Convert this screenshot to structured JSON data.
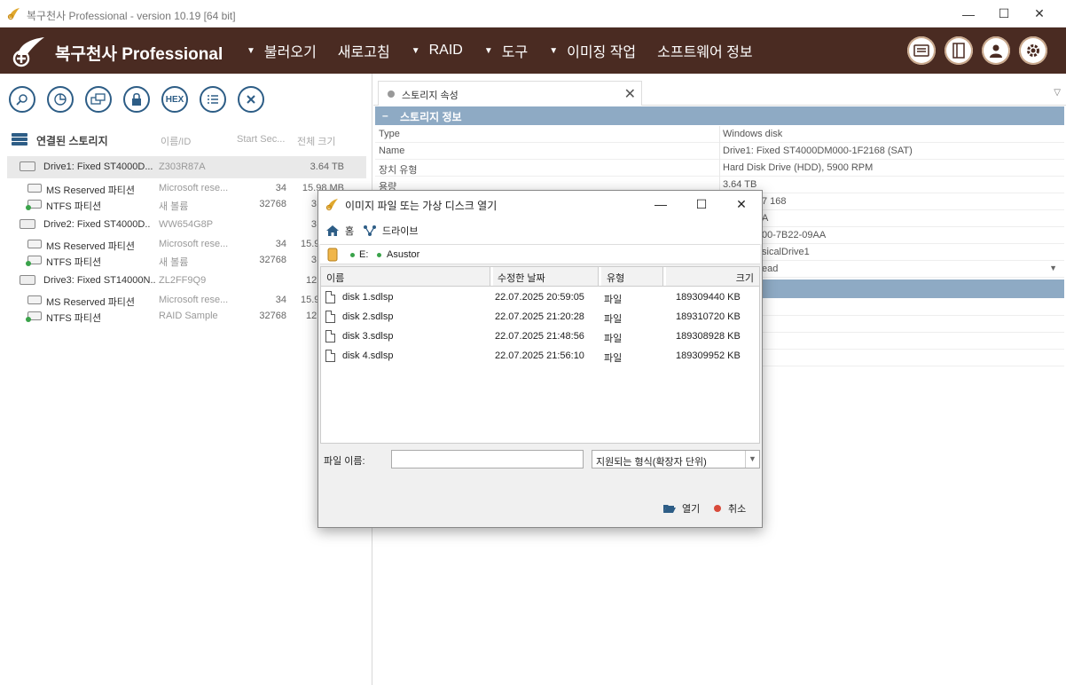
{
  "window": {
    "title": "복구천사 Professional - version 10.19 [64 bit]",
    "controls": {
      "minimize": "—",
      "maximize": "☐",
      "close": "✕"
    }
  },
  "header": {
    "brand": "복구천사 Professional",
    "menu": [
      {
        "label": "불러오기",
        "dropdown": true
      },
      {
        "label": "새로고침",
        "dropdown": false
      },
      {
        "label": "RAID",
        "dropdown": true
      },
      {
        "label": "도구",
        "dropdown": true
      },
      {
        "label": "이미징 작업",
        "dropdown": true
      },
      {
        "label": "소프트웨어 정보",
        "dropdown": false
      }
    ],
    "colors": {
      "bar": "#4a2b22"
    }
  },
  "toolbar": {
    "hex_label": "HEX",
    "icons": [
      "search-icon",
      "pie-chart-icon",
      "copy-disk-icon",
      "lock-icon",
      "hex-icon",
      "list-icon",
      "close-icon"
    ]
  },
  "tree": {
    "title": "연결된 스토리지",
    "columns": {
      "name_id": "이름/ID",
      "start": "Start Sec...",
      "size": "전체 크기"
    },
    "rows": [
      {
        "type": "disk",
        "name": "Drive1: Fixed ST4000D...",
        "id": "Z303R87A",
        "start": "",
        "size": "3.64 TB",
        "selected": true
      },
      {
        "type": "part",
        "name": "MS Reserved 파티션",
        "id": "Microsoft rese...",
        "start": "34",
        "size": "15.98 MB",
        "green": false
      },
      {
        "type": "part",
        "name": "NTFS 파티션",
        "id": "새 볼륨",
        "start": "32768",
        "size": "3",
        "green": true
      },
      {
        "type": "disk",
        "name": "Drive2: Fixed ST4000D...",
        "id": "WW654G8P",
        "start": "",
        "size": "3",
        "selected": false
      },
      {
        "type": "part",
        "name": "MS Reserved 파티션",
        "id": "Microsoft rese...",
        "start": "34",
        "size": "15.9",
        "green": false
      },
      {
        "type": "part",
        "name": "NTFS 파티션",
        "id": "새 볼륨",
        "start": "32768",
        "size": "3",
        "green": true
      },
      {
        "type": "disk",
        "name": "Drive3: Fixed ST14000N...",
        "id": "ZL2FF9Q9",
        "start": "",
        "size": "12",
        "selected": false
      },
      {
        "type": "part",
        "name": "MS Reserved 파티션",
        "id": "Microsoft rese...",
        "start": "34",
        "size": "15.9",
        "green": false
      },
      {
        "type": "part",
        "name": "NTFS 파티션",
        "id": "RAID Sample",
        "start": "32768",
        "size": "12",
        "green": true
      }
    ]
  },
  "panel": {
    "tab_label": "스토리지 속성",
    "section1": "스토리지 정보",
    "section1_sign": "–",
    "props": [
      {
        "k": "Type",
        "v": "Windows disk"
      },
      {
        "k": "Name",
        "v": "Drive1: Fixed ST4000DM000-1F2168 (SAT)"
      },
      {
        "k": "장치 유형",
        "v": "Hard Disk Drive (HDD), 5900 RPM"
      },
      {
        "k": "용량",
        "v": "3.64 TB"
      },
      {
        "k": "",
        "v": "7 168"
      },
      {
        "k": "",
        "v": "A"
      },
      {
        "k": "",
        "v": "00-7B22-09AA"
      },
      {
        "k": "",
        "v": "sicalDrive1"
      },
      {
        "k": "",
        "v": "ead"
      }
    ],
    "accent": "#8eaac4"
  },
  "dialog": {
    "title": "이미지 파일 또는 가상 디스크 열기",
    "nav": {
      "home": "홈",
      "drives": "드라이브"
    },
    "path": {
      "drive": "E:",
      "folder": "Asustor"
    },
    "columns": {
      "name": "이름",
      "modified": "수정한 날짜",
      "type": "유형",
      "size": "크기"
    },
    "files": [
      {
        "name": "disk 1.sdlsp",
        "modified": "22.07.2025 20:59:05",
        "type": "파일",
        "size": "189309440 KB"
      },
      {
        "name": "disk 2.sdlsp",
        "modified": "22.07.2025 21:20:28",
        "type": "파일",
        "size": "189310720 KB"
      },
      {
        "name": "disk 3.sdlsp",
        "modified": "22.07.2025 21:48:56",
        "type": "파일",
        "size": "189308928 KB"
      },
      {
        "name": "disk 4.sdlsp",
        "modified": "22.07.2025 21:56:10",
        "type": "파일",
        "size": "189309952 KB"
      }
    ],
    "filename_label": "파일 이름:",
    "filename_value": "",
    "filetype": "지원되는 형식(확장자 단위)",
    "open_label": "열기",
    "cancel_label": "취소"
  }
}
